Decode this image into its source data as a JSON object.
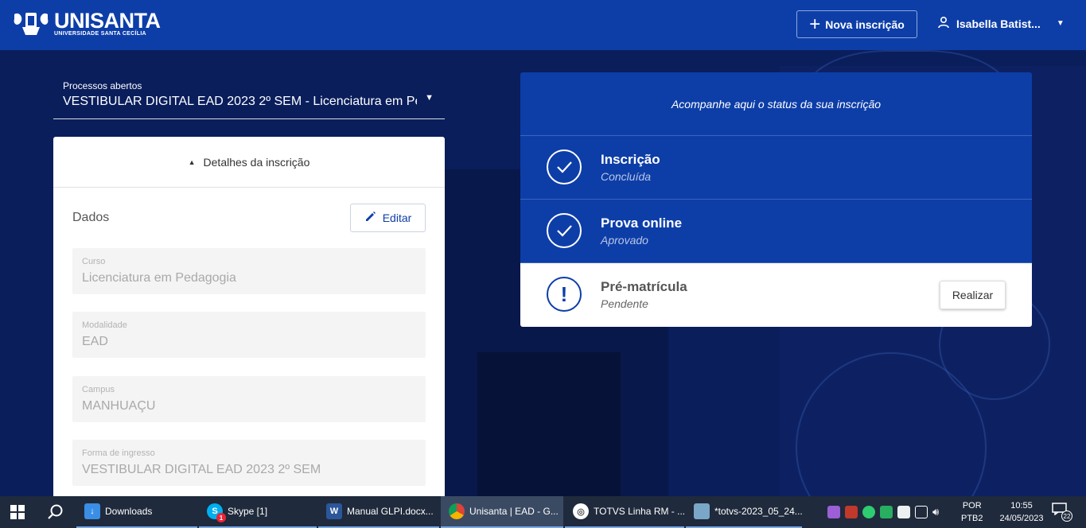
{
  "header": {
    "logo_title": "UNISANTA",
    "logo_subtitle": "UNIVERSIDADE SANTA CECÍLIA",
    "new_button_label": "Nova inscrição",
    "user_name": "Isabella Batist..."
  },
  "process": {
    "label": "Processos abertos",
    "value": "VESTIBULAR DIGITAL EAD 2023 2º SEM - Licenciatura em Pe..."
  },
  "details": {
    "header_label": "Detalhes da inscrição",
    "section_title": "Dados",
    "edit_label": "Editar",
    "fields": [
      {
        "label": "Curso",
        "value": "Licenciatura em Pedagogia"
      },
      {
        "label": "Modalidade",
        "value": "EAD"
      },
      {
        "label": "Campus",
        "value": "MANHUAÇU"
      },
      {
        "label": "Forma de ingresso",
        "value": "VESTIBULAR DIGITAL EAD 2023 2º SEM"
      }
    ]
  },
  "status": {
    "heading": "Acompanhe aqui o status da sua inscrição",
    "steps": [
      {
        "title": "Inscrição",
        "state": "Concluída",
        "icon": "check-icon"
      },
      {
        "title": "Prova online",
        "state": "Aprovado",
        "icon": "check-icon"
      },
      {
        "title": "Pré-matrícula",
        "state": "Pendente",
        "icon": "exclamation-icon",
        "action": "Realizar"
      }
    ]
  },
  "taskbar": {
    "apps": [
      {
        "label": "Downloads",
        "icon": "download-icon",
        "color": "#3a8ee6"
      },
      {
        "label": "Skype [1]",
        "icon": "skype-icon",
        "color": "#00aff0",
        "badge": "1"
      },
      {
        "label": "Manual GLPI.docx...",
        "icon": "word-icon",
        "color": "#2b579a"
      },
      {
        "label": "Unisanta | EAD - G...",
        "icon": "chrome-icon",
        "color": "#e8b400"
      },
      {
        "label": "TOTVS Linha RM - ...",
        "icon": "totvs-icon",
        "color": "#555555"
      },
      {
        "label": "*totvs-2023_05_24...",
        "icon": "notepad-icon",
        "color": "#7aa6c8"
      }
    ],
    "lang_top": "POR",
    "lang_bottom": "PTB2",
    "time": "10:55",
    "date": "24/05/2023",
    "notifications": "22"
  },
  "colors": {
    "primary": "#0d3ea8",
    "background": "#0a1e5c",
    "taskbar": "#1f2a3c"
  }
}
